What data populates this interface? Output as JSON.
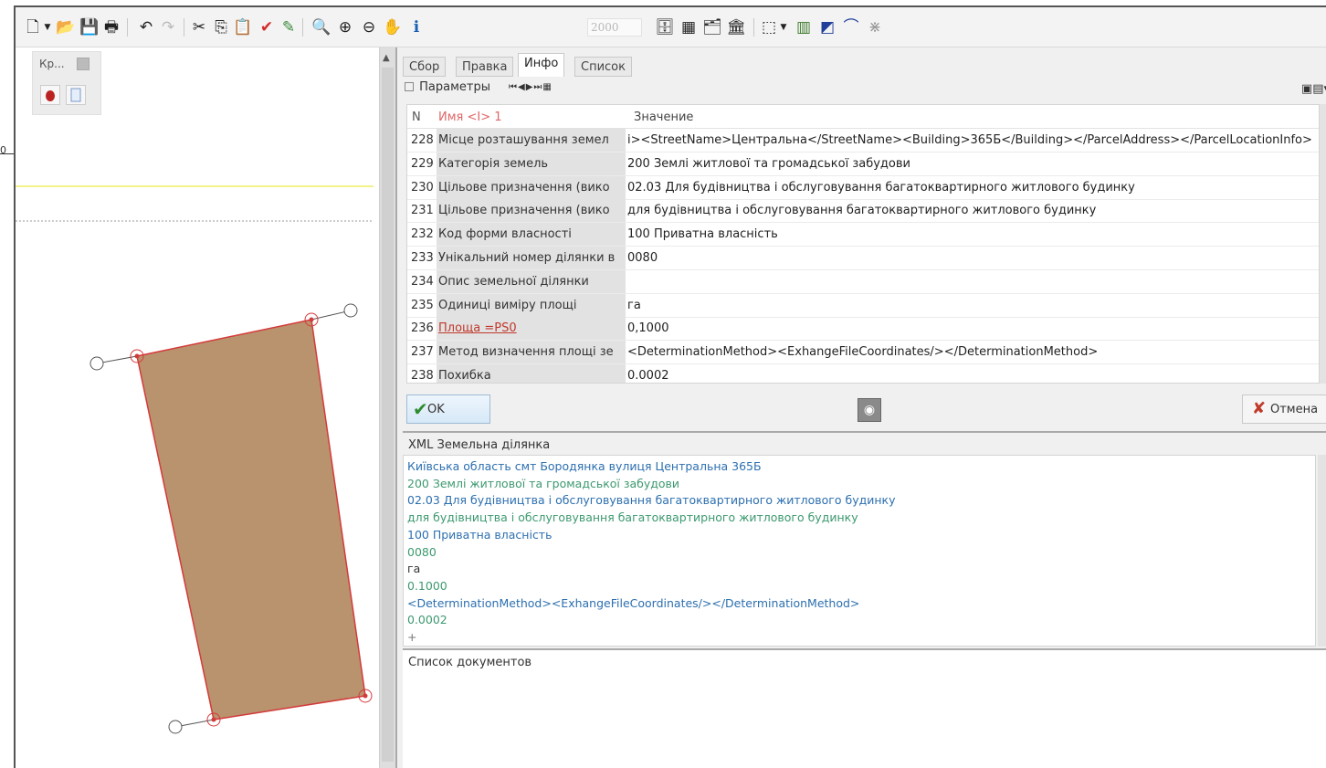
{
  "window": {
    "stub_label": "0"
  },
  "toolbar": {
    "zoom_value": "2000"
  },
  "palette": {
    "title": "Кр..."
  },
  "tabs": [
    {
      "label": "Сбор"
    },
    {
      "label": "Правка"
    },
    {
      "label": "Инфо"
    },
    {
      "label": "Список"
    }
  ],
  "active_tab": "Инфо",
  "params": {
    "label": "Параметры"
  },
  "grid": {
    "headers": {
      "n": "N",
      "name": "Имя <I> 1",
      "value": "Значение"
    },
    "rows": [
      {
        "n": "228",
        "name": "Місце розташування земел",
        "value": "і><StreetName>Центральна</StreetName><Building>365Б</Building></ParcelAddress></ParcelLocationInfo>",
        "link": false
      },
      {
        "n": "229",
        "name": "Категорія земель",
        "value": "200 Землі житлової та громадської забудови",
        "link": false
      },
      {
        "n": "230",
        "name": "Цільове призначення (вико",
        "value": "02.03 Для будівництва і обслуговування багатоквартирного житлового будинку",
        "link": false
      },
      {
        "n": "231",
        "name": "Цільове призначення (вико",
        "value": "для будівництва і обслуговування багатоквартирного житлового будинку",
        "link": false
      },
      {
        "n": "232",
        "name": "Код форми власності",
        "value": "100 Приватна власність",
        "link": false
      },
      {
        "n": "233",
        "name": "Унікальний номер ділянки в",
        "value": "0080",
        "link": false
      },
      {
        "n": "234",
        "name": "Опис земельної ділянки",
        "value": "",
        "link": false
      },
      {
        "n": "235",
        "name": "Одиниці виміру площі",
        "value": "га",
        "link": false
      },
      {
        "n": "236",
        "name": "Площа =PS0",
        "value": "0,1000",
        "link": true
      },
      {
        "n": "237",
        "name": "Метод визначення площі зе",
        "value": "<DeterminationMethod><ExhangeFileCoordinates/></DeterminationMethod>",
        "link": false
      },
      {
        "n": "238",
        "name": "Похибка",
        "value": "0.0002",
        "link": false
      }
    ]
  },
  "buttons": {
    "ok": "OK",
    "cancel": "Отмена"
  },
  "xml": {
    "title": "XML Земельна ділянка",
    "lines": [
      {
        "text": "Київська область смт Бородянка вулиця Центральна 365Б",
        "color": "blue"
      },
      {
        "text": "200 Землі житлової та громадської забудови",
        "color": "green"
      },
      {
        "text": "02.03 Для будівництва і обслуговування багатоквартирного житлового будинку",
        "color": "blue"
      },
      {
        "text": "для будівництва і обслуговування багатоквартирного житлового будинку",
        "color": "green"
      },
      {
        "text": "100 Приватна власність",
        "color": "blue"
      },
      {
        "text": "0080",
        "color": "green"
      },
      {
        "text": "га",
        "color": "dark"
      },
      {
        "text": "0.1000",
        "color": "green"
      },
      {
        "text": "<DeterminationMethod><ExhangeFileCoordinates/></DeterminationMethod>",
        "color": "blue"
      },
      {
        "text": "0.0002",
        "color": "green"
      },
      {
        "text": "+",
        "color": "gray"
      }
    ]
  },
  "docs": {
    "title": "Список документов"
  },
  "colors": {
    "parcel_fill": "#b9936d",
    "parcel_stroke": "#d43a3a",
    "highlight_line": "#f2f28a"
  }
}
